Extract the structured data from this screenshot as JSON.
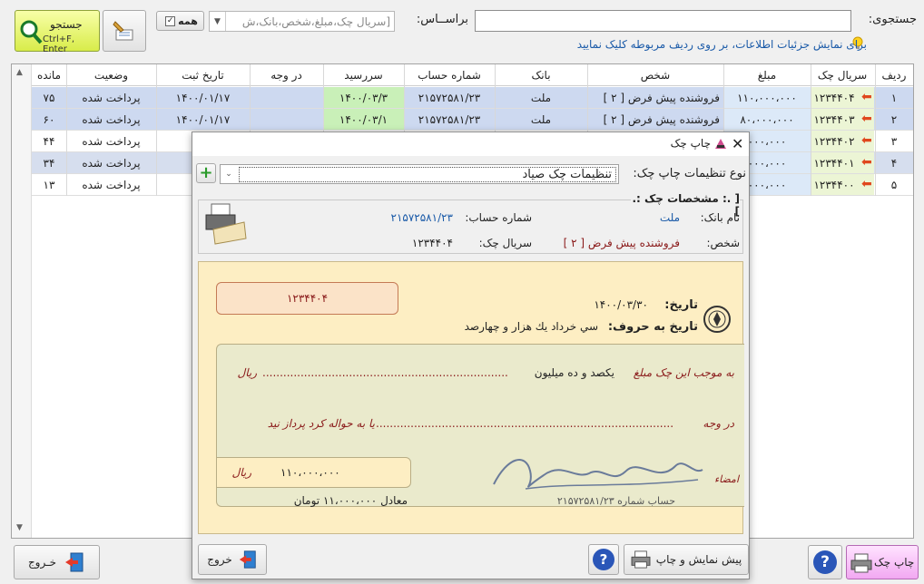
{
  "search": {
    "label": "جستجوی:",
    "value": "",
    "hint": "برای نمایش جزئیات اطلاعات، بر روی ردیف مربوطه کلیک نمایید"
  },
  "based_on": {
    "label": "براســاس:",
    "value": "[سریال چک،مبلغ،شخص،بانک،ش"
  },
  "all_label": "همه",
  "search_button": {
    "label": "جستجو",
    "shortcut": "Ctrl+F, Enter"
  },
  "table": {
    "headers": [
      "ردیف",
      "سریال چک",
      "مبلغ",
      "شخص",
      "بانک",
      "شماره حساب",
      "سررسید",
      "در وجه",
      "تاریخ ثبت",
      "وضعیت",
      "مانده"
    ],
    "rows": [
      {
        "idx": "۱",
        "serial": "۱۲۳۴۴۰۴",
        "amount": "۱۱۰،۰۰۰،۰۰۰",
        "person": "فروشنده پیش فرض [ ۲ ]",
        "bank": "ملت",
        "account": "۲۱۵۷۲۵۸۱/۲۳",
        "due": "۱۴۰۰/۰۳/۳",
        "payee": "",
        "reg": "۱۴۰۰/۰۱/۱۷",
        "status": "پرداخت شده",
        "rem": "۷۵"
      },
      {
        "idx": "۲",
        "serial": "۱۲۳۴۴۰۳",
        "amount": "۸۰،۰۰۰،۰۰۰",
        "person": "فروشنده پیش فرض [ ۲ ]",
        "bank": "ملت",
        "account": "۲۱۵۷۲۵۸۱/۲۳",
        "due": "۱۴۰۰/۰۳/۱",
        "payee": "",
        "reg": "۱۴۰۰/۰۱/۱۷",
        "status": "پرداخت شده",
        "rem": "۶۰"
      },
      {
        "idx": "۳",
        "serial": "۱۲۳۴۴۰۲",
        "amount": "۰۰۰،۰۰۰",
        "person": "",
        "bank": "",
        "account": "",
        "due": "",
        "payee": "",
        "reg": "۱۴۰۰",
        "status": "پرداخت شده",
        "rem": "۴۴"
      },
      {
        "idx": "۴",
        "serial": "۱۲۳۴۴۰۱",
        "amount": "۰۰۰،۰۰۰",
        "person": "",
        "bank": "",
        "account": "",
        "due": "",
        "payee": "",
        "reg": "۱۴۰۰",
        "status": "پرداخت شده",
        "rem": "۳۴"
      },
      {
        "idx": "۵",
        "serial": "۱۲۳۴۴۰۰",
        "amount": "۰۰۰،۰۰۰",
        "person": "",
        "bank": "",
        "account": "",
        "due": "",
        "payee": "",
        "reg": "۱۴۰۰",
        "status": "پرداخت شده",
        "rem": "۱۳"
      }
    ]
  },
  "bottom": {
    "print_label": "چاپ چک",
    "exit_label": "خـروج"
  },
  "dialog": {
    "title": "چاپ چک",
    "settings_label": "نوع تنظیمات چاپ چک:",
    "settings_value": "تنظیمات چک صیاد",
    "group_title": "[ .: مشخصات چک :. ]",
    "bank_label": "نام بانک:",
    "bank_value": "ملت",
    "account_label": "شماره حساب:",
    "account_value": "۲۱۵۷۲۵۸۱/۲۳",
    "person_label": "شخص:",
    "person_value": "فروشنده پیش فرض [ ۲ ]",
    "serial_label": "سریال چک:",
    "serial_value": "۱۲۳۴۴۰۴",
    "preview_label": "پیش نمایش و چاپ",
    "exit_label": "خروج"
  },
  "cheque": {
    "serial": "۱۲۳۴۴۰۴",
    "date_label": "تاریخ:",
    "date_value": "۱۴۰۰/۰۳/۳۰",
    "words_label": "تاریخ به حروف:",
    "words_value": "سي   خرداد يك هزار و چهارصد",
    "amount_prefix": "به موجب این چک مبلغ",
    "amount_words": "يكصد و ده ميليون",
    "rial": "ریال",
    "to_prefix": "در وجه",
    "to_suffix": "یا به حواله کرد پرداز نید",
    "amount_digits": "۱۱۰،۰۰۰،۰۰۰",
    "toman_line": "معادل ۱۱،۰۰۰،۰۰۰ تومان",
    "sign_label": "امضاء",
    "account_line": "حساب شماره ۲۱۵۷۲۵۸۱/۲۳"
  }
}
